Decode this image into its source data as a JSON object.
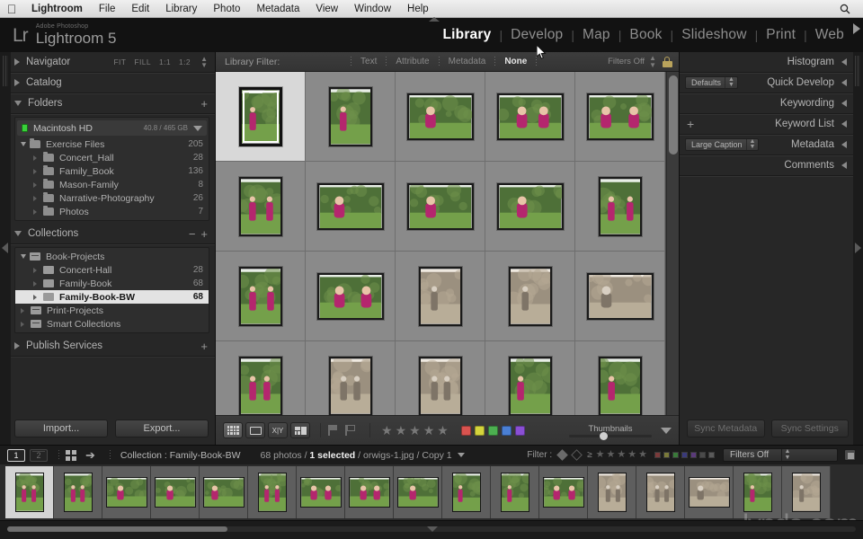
{
  "macbar": {
    "apple_icon": "apple-logo",
    "items": [
      "Lightroom",
      "File",
      "Edit",
      "Library",
      "Photo",
      "Metadata",
      "View",
      "Window",
      "Help"
    ],
    "spotlight_icon": "search-icon"
  },
  "identity": {
    "mark": "Lr",
    "superline": "Adobe Photoshop",
    "product": "Lightroom 5"
  },
  "modules": {
    "items": [
      "Library",
      "Develop",
      "Map",
      "Book",
      "Slideshow",
      "Print",
      "Web"
    ],
    "active": "Library",
    "separator": "|"
  },
  "left_panel": {
    "navigator": {
      "title": "Navigator",
      "modes": [
        "FIT",
        "FILL",
        "1:1",
        "1:2"
      ]
    },
    "catalog": {
      "title": "Catalog"
    },
    "folders": {
      "title": "Folders",
      "add_icon": "plus-icon",
      "volume": {
        "name": "Macintosh HD",
        "size": "40.8 / 465 GB",
        "led_color": "#39d13a"
      },
      "items": [
        {
          "name": "Exercise Files",
          "count": "205",
          "depth": 0,
          "expanded": true
        },
        {
          "name": "Concert_Hall",
          "count": "28",
          "depth": 1,
          "expanded": false
        },
        {
          "name": "Family_Book",
          "count": "136",
          "depth": 1,
          "expanded": false
        },
        {
          "name": "Mason-Family",
          "count": "8",
          "depth": 1,
          "expanded": false
        },
        {
          "name": "Narrative-Photography",
          "count": "26",
          "depth": 1,
          "expanded": false
        },
        {
          "name": "Photos",
          "count": "7",
          "depth": 1,
          "expanded": false
        }
      ]
    },
    "collections": {
      "title": "Collections",
      "remove_icon": "minus-icon",
      "add_icon": "plus-icon",
      "items": [
        {
          "name": "Book-Projects",
          "count": "",
          "depth": 0,
          "expanded": true,
          "selected": false
        },
        {
          "name": "Concert-Hall",
          "count": "28",
          "depth": 1,
          "expanded": false,
          "selected": false
        },
        {
          "name": "Family-Book",
          "count": "68",
          "depth": 1,
          "expanded": false,
          "selected": false
        },
        {
          "name": "Family-Book-BW",
          "count": "68",
          "depth": 1,
          "expanded": false,
          "selected": true
        },
        {
          "name": "Print-Projects",
          "count": "",
          "depth": 0,
          "expanded": false,
          "selected": false
        },
        {
          "name": "Smart Collections",
          "count": "",
          "depth": 0,
          "expanded": false,
          "selected": false
        }
      ]
    },
    "publish_services": {
      "title": "Publish Services",
      "add_icon": "plus-icon"
    },
    "buttons": {
      "import": "Import...",
      "export": "Export..."
    }
  },
  "library_filter": {
    "label": "Library Filter:",
    "tabs": [
      "Text",
      "Attribute",
      "Metadata",
      "None"
    ],
    "active_tab": "None",
    "filters_off": "Filters Off",
    "lock_icon": "lock-icon"
  },
  "grid": {
    "columns": 5,
    "selected_index": 0,
    "cells": [
      {
        "orient": "portrait",
        "tone": "color",
        "seed": 1
      },
      {
        "orient": "portrait",
        "tone": "color",
        "seed": 2
      },
      {
        "orient": "landscape",
        "tone": "color",
        "seed": 3
      },
      {
        "orient": "landscape",
        "tone": "color",
        "seed": 4
      },
      {
        "orient": "landscape",
        "tone": "color",
        "seed": 5
      },
      {
        "orient": "portrait",
        "tone": "color",
        "seed": 6
      },
      {
        "orient": "landscape",
        "tone": "color",
        "seed": 7
      },
      {
        "orient": "landscape",
        "tone": "color",
        "seed": 8
      },
      {
        "orient": "landscape",
        "tone": "color",
        "seed": 9
      },
      {
        "orient": "portrait",
        "tone": "color",
        "seed": 10
      },
      {
        "orient": "portrait",
        "tone": "color",
        "seed": 11
      },
      {
        "orient": "landscape",
        "tone": "color",
        "seed": 12
      },
      {
        "orient": "portrait",
        "tone": "sepia",
        "seed": 13
      },
      {
        "orient": "portrait",
        "tone": "sepia",
        "seed": 14
      },
      {
        "orient": "landscape",
        "tone": "sepia",
        "seed": 15
      },
      {
        "orient": "portrait",
        "tone": "color",
        "seed": 16
      },
      {
        "orient": "portrait",
        "tone": "sepia",
        "seed": 17
      },
      {
        "orient": "portrait",
        "tone": "sepia",
        "seed": 18
      },
      {
        "orient": "portrait",
        "tone": "color",
        "seed": 19
      },
      {
        "orient": "portrait",
        "tone": "color",
        "seed": 20
      }
    ]
  },
  "toolbar": {
    "view_modes": [
      {
        "icon": "grid-view-icon",
        "active": true
      },
      {
        "icon": "loupe-view-icon",
        "active": false
      },
      {
        "icon": "compare-view-icon",
        "active": false
      },
      {
        "icon": "survey-view-icon",
        "active": false
      }
    ],
    "flags": [
      "flag-pick-icon",
      "flag-reject-icon"
    ],
    "stars": 5,
    "star_glyph": "★",
    "color_labels": [
      "#d9534f",
      "#d4d43c",
      "#4caf50",
      "#4a7fd4",
      "#8a4fd4"
    ],
    "thumbnails_label": "Thumbnails",
    "thumbnails_value": 37,
    "caret_icon": "chevron-down-icon"
  },
  "right_panel": {
    "sections": [
      {
        "title": "Histogram",
        "control": "none"
      },
      {
        "title": "Quick Develop",
        "control": "combo",
        "combo_value": "Defaults"
      },
      {
        "title": "Keywording",
        "control": "none"
      },
      {
        "title": "Keyword List",
        "control": "plus"
      },
      {
        "title": "Metadata",
        "control": "combo",
        "combo_value": "Large Caption"
      },
      {
        "title": "Comments",
        "control": "none"
      }
    ],
    "buttons": {
      "sync_metadata": "Sync Metadata",
      "sync_settings": "Sync Settings"
    }
  },
  "filmstrip_status": {
    "screen1": "1",
    "screen2": "2",
    "grid_icon": "grid-view-icon",
    "back_icon": "arrow-left-icon",
    "forward_icon": "arrow-right-icon",
    "source": "Collection : Family-Book-BW",
    "photo_count": "68 photos",
    "selected_text": "1 selected",
    "filename": "orwigs-1.jpg",
    "copy": "Copy 1",
    "separator": "/",
    "filter_label": "Filter :",
    "filter_stars": 5,
    "ge_glyph": "≥",
    "color_labels": [
      "#7a3a3a",
      "#7a7a3a",
      "#3a7a3a",
      "#3a3a7a",
      "#5a3a7a",
      "#4a4a4a",
      "#5a5a5a"
    ],
    "filters_off": "Filters Off"
  },
  "filmstrip": {
    "selected_index": 0,
    "next_icon": "arrow-right-icon",
    "cells": [
      {
        "orient": "portrait",
        "tone": "color"
      },
      {
        "orient": "portrait",
        "tone": "color"
      },
      {
        "orient": "landscape",
        "tone": "color"
      },
      {
        "orient": "landscape",
        "tone": "color"
      },
      {
        "orient": "landscape",
        "tone": "color"
      },
      {
        "orient": "portrait",
        "tone": "color"
      },
      {
        "orient": "landscape",
        "tone": "color"
      },
      {
        "orient": "landscape",
        "tone": "color"
      },
      {
        "orient": "landscape",
        "tone": "color"
      },
      {
        "orient": "portrait",
        "tone": "color"
      },
      {
        "orient": "portrait",
        "tone": "color"
      },
      {
        "orient": "landscape",
        "tone": "color"
      },
      {
        "orient": "portrait",
        "tone": "sepia"
      },
      {
        "orient": "portrait",
        "tone": "sepia"
      },
      {
        "orient": "landscape",
        "tone": "sepia"
      },
      {
        "orient": "portrait",
        "tone": "color"
      },
      {
        "orient": "portrait",
        "tone": "sepia"
      }
    ]
  },
  "watermark": {
    "text": "lynda.com"
  }
}
